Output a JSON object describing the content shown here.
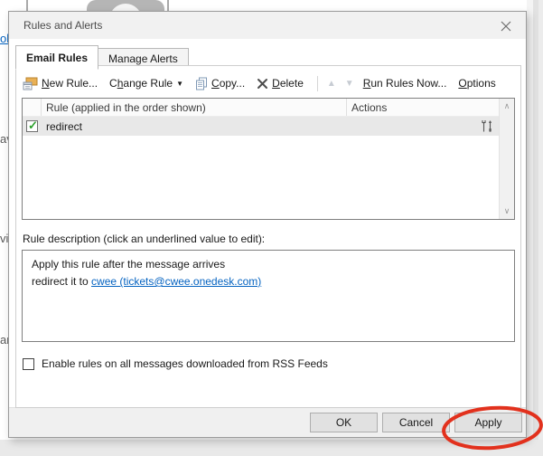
{
  "background": {
    "fragments": {
      "f0": "ob",
      "f1": "av",
      "f2": "vi",
      "f3": "ar"
    }
  },
  "dialog": {
    "title": "Rules and Alerts",
    "tabs": {
      "email_rules": "Email Rules",
      "manage_alerts": "Manage Alerts"
    },
    "toolbar": {
      "new_rule": {
        "key": "N",
        "post": "ew Rule..."
      },
      "change_rule": {
        "pre": "C",
        "key": "h",
        "post": "ange Rule"
      },
      "copy": {
        "key": "C",
        "post": "opy..."
      },
      "delete": {
        "key": "D",
        "post": "elete"
      },
      "run_rules": {
        "key": "R",
        "post": "un Rules Now..."
      },
      "options": {
        "key": "O",
        "post": "ptions"
      }
    },
    "table": {
      "headers": {
        "rule": "Rule (applied in the order shown)",
        "actions": "Actions"
      },
      "rows": [
        {
          "name": "redirect",
          "checked": true
        }
      ]
    },
    "description": {
      "label": "Rule description (click an underlined value to edit):",
      "line1": "Apply this rule after the message arrives",
      "line2_prefix": "redirect it to ",
      "line2_link": "cwee (tickets@cwee.onedesk.com)"
    },
    "rss_checkbox_label": "Enable rules on all messages downloaded from RSS Feeds",
    "footer": {
      "ok": "OK",
      "cancel": "Cancel",
      "apply": "Apply"
    }
  },
  "icons": {
    "close": "×",
    "dropdown": "▼",
    "move_up": "▲",
    "move_down": "▼",
    "scroll_up": "∧",
    "scroll_down": "∨",
    "check": "✓"
  },
  "colors": {
    "link": "#0563c1",
    "annotation_red": "#e2311d",
    "check_green": "#2ca12c",
    "selected_row": "#e8e8e8"
  },
  "annotation": {
    "shape": "hand-drawn-circle",
    "target": "apply-button"
  }
}
